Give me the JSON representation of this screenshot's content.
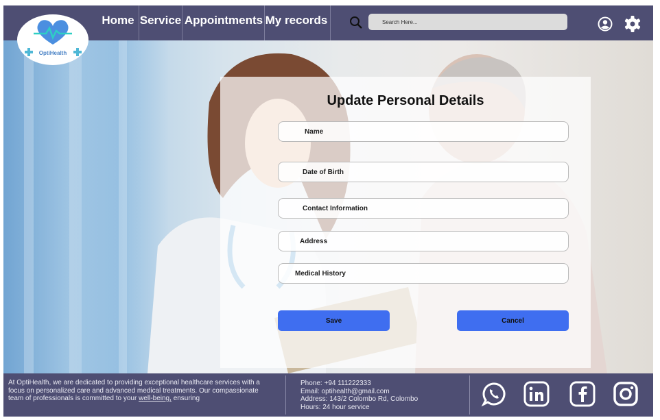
{
  "brand": {
    "name": "OptiHealth"
  },
  "nav": {
    "items": [
      {
        "label": "Home"
      },
      {
        "label": "Service"
      },
      {
        "label": "Appointments"
      },
      {
        "label": "My records"
      }
    ]
  },
  "search": {
    "placeholder": "Search Here..."
  },
  "form": {
    "title": "Update Personal Details",
    "fields": [
      {
        "placeholder": "Name"
      },
      {
        "placeholder": "Date of Birth"
      },
      {
        "placeholder": "Contact Information"
      },
      {
        "placeholder": "Address"
      },
      {
        "placeholder": "Medical History"
      }
    ],
    "save_label": "Save",
    "cancel_label": "Cancel"
  },
  "footer": {
    "about_text": "At OptiHealth, we are dedicated to providing exceptional healthcare services with a focus on personalized care and advanced medical treatments. Our compassionate team of professionals is committed to your",
    "about_link": "well-being,",
    "about_tail": "ensuring",
    "phone": "Phone: +94 111222333",
    "email": "Email: optihealth@gmail.com",
    "address": "Address: 143/2 Colombo Rd, Colombo",
    "hours": "Hours: 24 hour service"
  },
  "icons": {
    "search": "search-icon",
    "user": "user-circle-icon",
    "settings": "gear-icon",
    "social": [
      "whatsapp-icon",
      "linkedin-icon",
      "facebook-icon",
      "instagram-icon"
    ]
  },
  "colors": {
    "header_bg": "#4e4e73",
    "button": "#3f6ef0",
    "logo_heart": "#4b8fe0",
    "logo_text": "#4b83c6"
  }
}
